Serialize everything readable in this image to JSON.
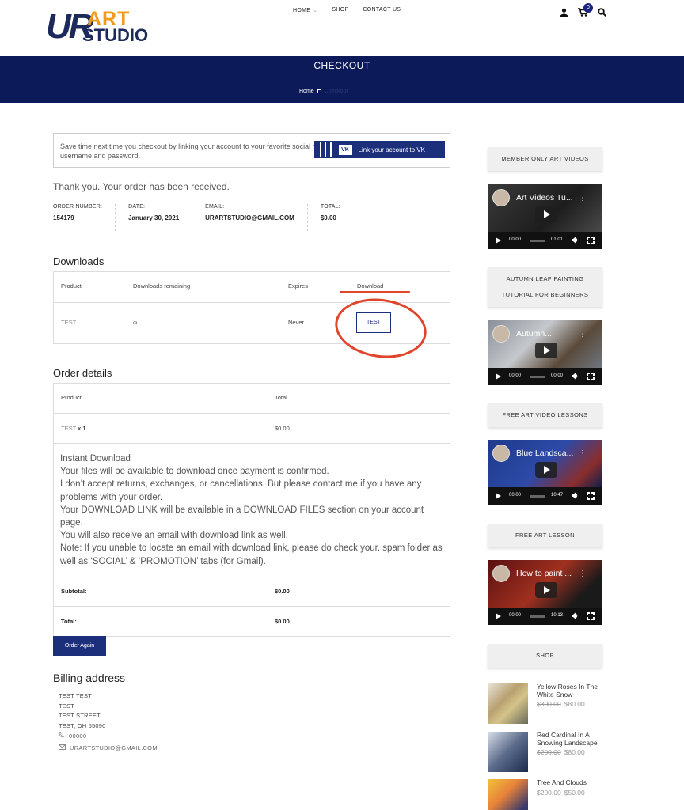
{
  "header": {
    "logo": {
      "part1": "UR",
      "part2": "ART",
      "part3": "STUDIO"
    },
    "nav": [
      "HOME",
      "SHOP",
      "CONTACT US"
    ],
    "cart_count": "0"
  },
  "banner": {
    "title": "CHECKOUT",
    "breadcrumb_home": "Home",
    "breadcrumb_current": "Checkout"
  },
  "vk": {
    "notice": "Save time next time you checkout by linking your account to your favorite social network. No need to remember another username and password.",
    "button": "Link your account to VK",
    "logo": "VK"
  },
  "thanks": "Thank you. Your order has been received.",
  "overview": [
    {
      "label": "ORDER NUMBER:",
      "value": "154179"
    },
    {
      "label": "DATE:",
      "value": "January 30, 2021"
    },
    {
      "label": "EMAIL:",
      "value": "URARTSTUDIO@GMAIL.COM"
    },
    {
      "label": "TOTAL:",
      "value": "$0.00"
    }
  ],
  "downloads": {
    "heading": "Downloads",
    "headers": [
      "Product",
      "Downloads remaining",
      "Expires",
      "Download"
    ],
    "row": {
      "product": "TEST",
      "remaining": "∞",
      "expires": "Never",
      "button": "TEST"
    }
  },
  "order_details": {
    "heading": "Order details",
    "headers": [
      "Product",
      "Total"
    ],
    "item": {
      "name": "TEST",
      "qty": "x 1",
      "total": "$0.00"
    },
    "instructions": [
      "Instant Download",
      "Your files will be available to download once payment is confirmed.",
      "I don’t accept returns, exchanges, or cancellations. But please contact me if you have any problems with your order.",
      "Your DOWNLOAD LINK will be available in a DOWNLOAD FILES section on your account page.",
      "You will also receive an email with download link as well.",
      "Note: If you unable to locate an email with download link, please do check your. spam folder as well as ‘SOCIAL’ & ‘PROMOTION’ tabs (for Gmail)."
    ],
    "subtotal_label": "Subtotal:",
    "subtotal": "$0.00",
    "total_label": "Total:",
    "total": "$0.00",
    "order_again": "Order Again"
  },
  "billing": {
    "heading": "Billing address",
    "lines": [
      "TEST TEST",
      "TEST",
      "TEST STREET",
      "TEST, OH 55090"
    ],
    "phone": "00000",
    "email": "URARTSTUDIO@GMAIL.COM"
  },
  "sidebar": {
    "widgets": [
      {
        "title": "MEMBER ONLY ART VIDEOS",
        "video_title": "Art Videos Tu...",
        "duration": "01:01",
        "time": "00:00"
      },
      {
        "title": "AUTUMN LEAF PAINTING TUTORIAL FOR BEGINNERS",
        "video_title": "Autumn...",
        "duration": "00:00",
        "time": "00:00"
      },
      {
        "title": "FREE ART VIDEO LESSONS",
        "video_title": "Blue Landsca...",
        "duration": "10:47",
        "time": "00:00"
      },
      {
        "title": "FREE ART LESSON",
        "video_title": "How to paint ...",
        "duration": "10:13",
        "time": "00:00"
      }
    ],
    "shop_title": "SHOP",
    "products": [
      {
        "name": "Yellow Roses In The White Snow",
        "old": "$300.00",
        "price": "$80.00"
      },
      {
        "name": "Red Cardinal In A Snowing Landscape",
        "old": "$200.00",
        "price": "$80.00"
      },
      {
        "name": "Tree And Clouds",
        "old": "$200.00",
        "price": "$50.00"
      }
    ]
  },
  "colors": {
    "navy": "#0c1a5a",
    "accent_red": "#e0452b",
    "logo_orange": "#f39a1c"
  }
}
